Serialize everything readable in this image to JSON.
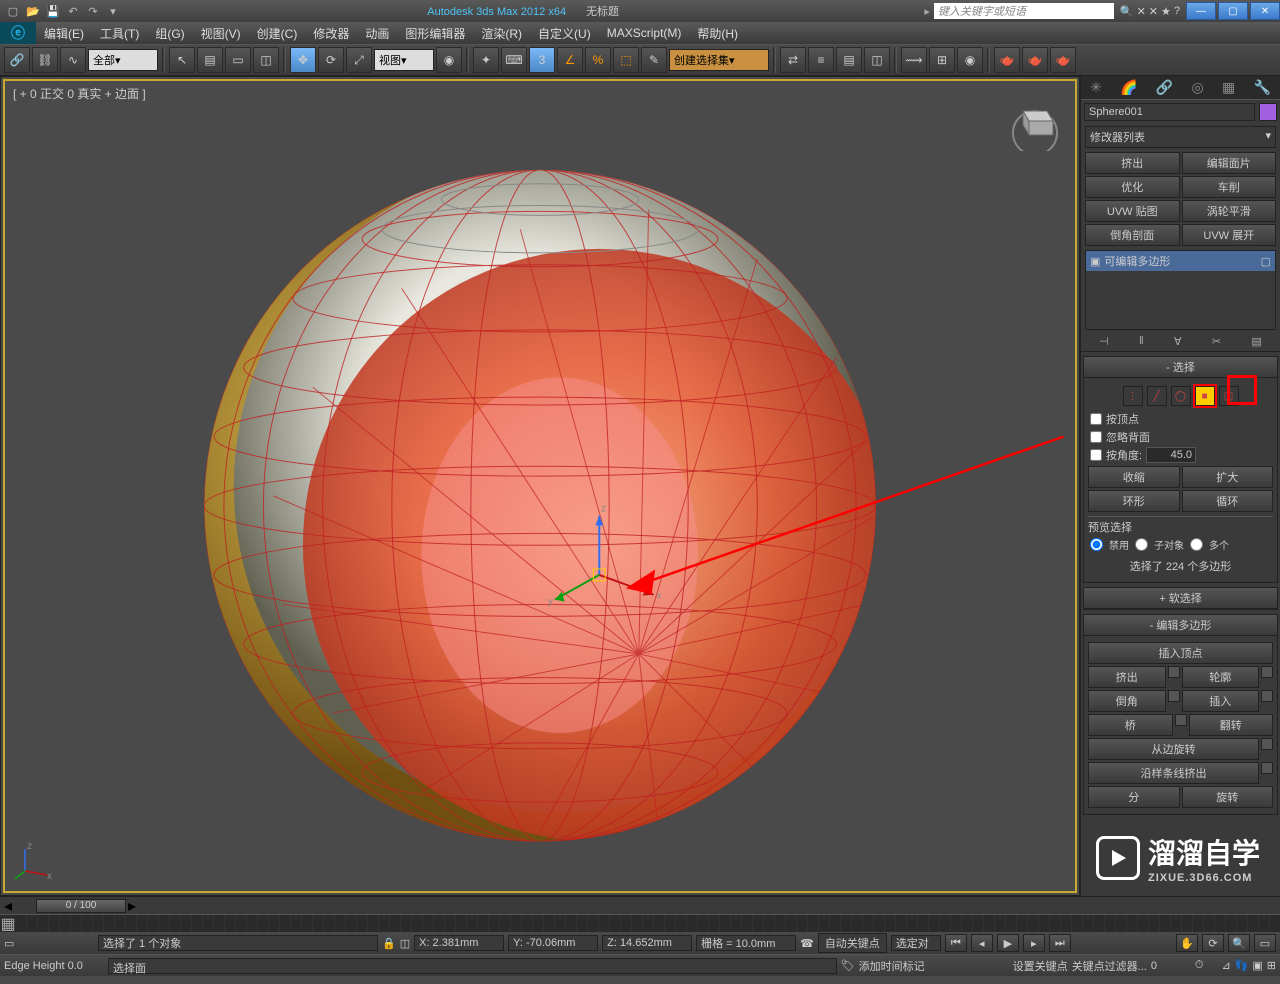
{
  "titlebar": {
    "app": "Autodesk 3ds Max 2012 x64",
    "doc": "无标题",
    "search_placeholder": "键入关键字或短语"
  },
  "menubar": {
    "items": [
      "编辑(E)",
      "工具(T)",
      "组(G)",
      "视图(V)",
      "创建(C)",
      "修改器",
      "动画",
      "图形编辑器",
      "渲染(R)",
      "自定义(U)",
      "MAXScript(M)",
      "帮助(H)"
    ]
  },
  "toolbar": {
    "all_label": "全部",
    "view_label": "视图",
    "create_set": "创建选择集"
  },
  "viewport": {
    "label": "[ + 0 正交 0 真实 + 边面 ]"
  },
  "cmdpanel": {
    "object_name": "Sphere001",
    "modlist_label": "修改器列表",
    "quickbtns": [
      [
        "挤出",
        "编辑面片"
      ],
      [
        "优化",
        "车削"
      ],
      [
        "UVW 贴图",
        "涡轮平滑"
      ],
      [
        "倒角剖面",
        "UVW 展开"
      ]
    ],
    "stack_item": "可编辑多边形",
    "selection": {
      "title": "选择",
      "by_vertex": "按顶点",
      "ignore_back": "忽略背面",
      "by_angle": "按角度:",
      "angle_value": "45.0",
      "shrink": "收缩",
      "grow": "扩大",
      "ring": "环形",
      "loop": "循环",
      "preview_label": "预览选择",
      "preview_off": "禁用",
      "preview_subobj": "子对象",
      "preview_multi": "多个",
      "selected_info": "选择了 224 个多边形"
    },
    "soft_sel": {
      "title": "软选择"
    },
    "edit_poly": {
      "title": "编辑多边形",
      "insert_vertex": "插入顶点",
      "extrude": "挤出",
      "outline": "轮廓",
      "bevel": "倒角",
      "inset": "插入",
      "bridge": "桥",
      "flip": "翻转",
      "hinge": "从边旋转",
      "extrude_spline": "沿样条线挤出",
      "chamfer?": "分",
      "rotate?": "旋转"
    }
  },
  "timeslider": {
    "pos": "0 / 100"
  },
  "status": {
    "selected": "选择了 1 个对象",
    "x": "X: 2.381mm",
    "y": "Y: -70.06mm",
    "z": "Z: 14.652mm",
    "grid": "栅格 = 10.0mm",
    "autokey": "自动关键点",
    "setkey": "设置关键点",
    "keyfilter": "关键点过滤器...",
    "selset_lock": "选定对",
    "addtag": "添加时间标记"
  },
  "status2": {
    "edge_height": "Edge Height 0.0",
    "prompt": "选择面"
  },
  "watermark": {
    "text": "溜溜自学",
    "url": "ZIXUE.3D66.COM"
  },
  "colors": {
    "viewport_border": "#c8a830",
    "object_color": "#a060e0",
    "highlight": "#ffcc00",
    "annotation_red": "#f00"
  }
}
